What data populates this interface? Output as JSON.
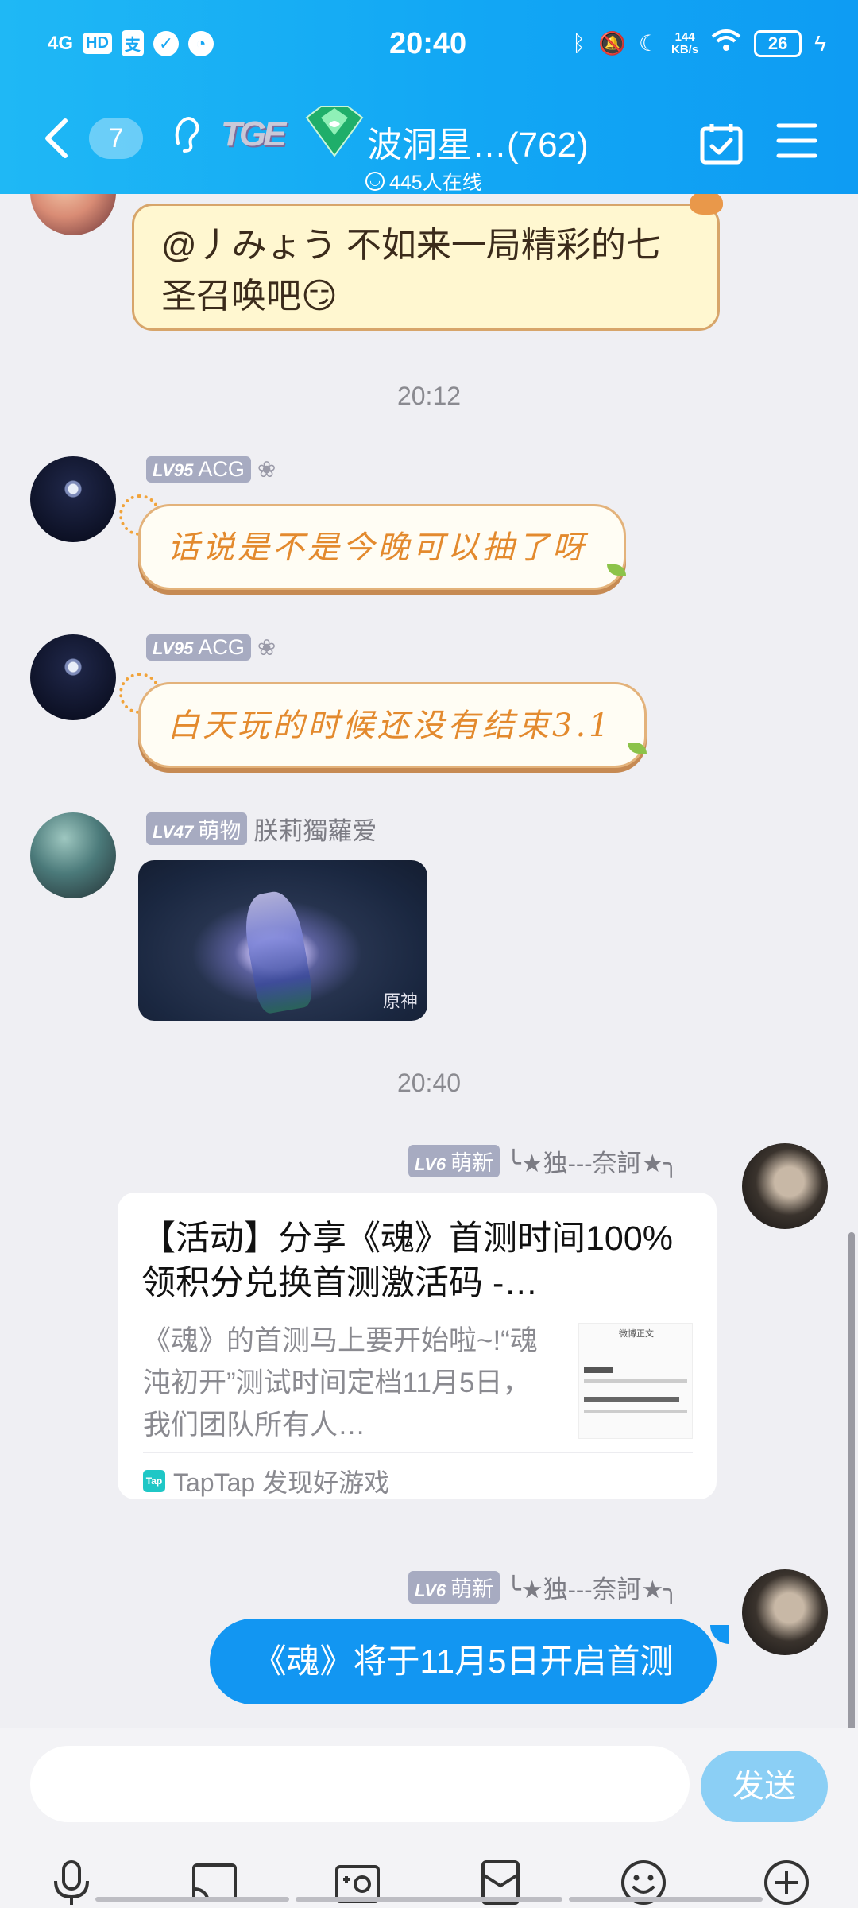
{
  "status_bar": {
    "network": "4G",
    "hd": "HD",
    "app1": "支",
    "time": "20:40",
    "speed_value": "144",
    "speed_unit": "KB/s",
    "battery": "26"
  },
  "header": {
    "unread_count": "7",
    "group_badge": "TGE",
    "group_name": "波洞星…",
    "member_count": "(762)",
    "online_text": "445人在线"
  },
  "messages": [
    {
      "type": "text-note",
      "text": "@丿みょう 不如来一局精彩的七圣召唤吧😏"
    },
    {
      "type": "timestamp",
      "text": "20:12"
    },
    {
      "type": "text-cute",
      "level": "LV95",
      "badge": "ACG",
      "text": "话说是不是今晚可以抽了呀"
    },
    {
      "type": "text-cute",
      "level": "LV95",
      "badge": "ACG",
      "text": "白天玩的时候还没有结束3.1"
    },
    {
      "type": "image",
      "level": "LV47",
      "badge": "萌物",
      "name": "朕莉獨蘿爱",
      "watermark": "原神"
    },
    {
      "type": "timestamp",
      "text": "20:40"
    },
    {
      "type": "card",
      "level": "LV6",
      "badge": "萌新",
      "name": "╰★独---奈訶★╮",
      "title": "【活动】分享《魂》首测时间100%领积分兑换首测激活码 -…",
      "description": "《魂》的首测马上要开始啦~!“魂沌初开”测试时间定档11月5日，我们团队所有人…",
      "thumb_heading": "微博正文",
      "source_icon": "Tap",
      "source": "TapTap 发现好游戏"
    },
    {
      "type": "text-blue",
      "level": "LV6",
      "badge": "萌新",
      "name": "╰★独---奈訶★╮",
      "text": "《魂》将于11月5日开启首测"
    }
  ],
  "composer": {
    "placeholder": "",
    "send_label": "发送"
  },
  "toolbar": [
    "microphone-icon",
    "screen-cast-icon",
    "photo-icon",
    "red-packet-icon",
    "emoji-icon",
    "plus-icon"
  ],
  "colors": {
    "header_start": "#1fb8f5",
    "header_end": "#0e9cf3",
    "bubble_blue": "#1296f2",
    "send_button": "#8bcff5",
    "level_badge": "#a7abc1"
  }
}
